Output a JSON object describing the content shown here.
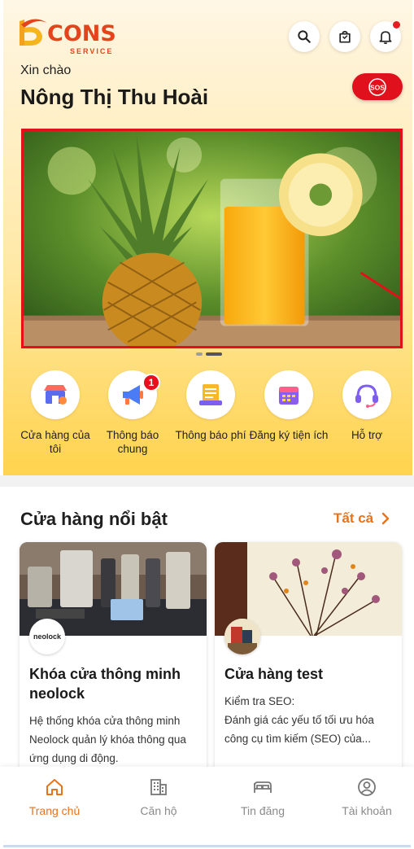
{
  "brand": {
    "name": "CONS",
    "sub": "SERVICE"
  },
  "header": {
    "greeting": "Xin chào",
    "user_name": "Nông Thị Thu Hoài",
    "sos_label": "SOS"
  },
  "colors": {
    "accent": "#e8731a",
    "sos": "#e0101c",
    "badge": "#e8101c",
    "gradient_bottom": "#ffd34d"
  },
  "banner": {
    "active_page": 2,
    "page_count": 2
  },
  "shortcuts": [
    {
      "label": "Cửa hàng của tôi",
      "icon": "store-icon"
    },
    {
      "label": "Thông báo chung",
      "icon": "megaphone-icon",
      "badge": "1"
    },
    {
      "label": "Thông báo phí",
      "icon": "fee-notice-icon"
    },
    {
      "label": "Đăng ký tiện ích",
      "icon": "calendar-icon"
    },
    {
      "label": "Hỗ trợ",
      "icon": "headset-icon"
    }
  ],
  "featured": {
    "title": "Cửa hàng nổi bật",
    "see_all": "Tất cả",
    "stores": [
      {
        "name": "Khóa cửa thông minh neolock",
        "avatar_text": "neolock",
        "description": "Hệ thống khóa cửa thông minh Neolock quản lý khóa thông qua ứng dụng di động."
      },
      {
        "name": "Cửa hàng test",
        "description_line1": "Kiểm tra SEO:",
        "description": "Đánh giá các yếu tố tối ưu hóa công cụ tìm kiếm (SEO) của..."
      }
    ]
  },
  "tabs": [
    {
      "label": "Trang chủ",
      "icon": "home-icon",
      "active": true
    },
    {
      "label": "Căn hộ",
      "icon": "building-icon"
    },
    {
      "label": "Tin đăng",
      "icon": "bed-icon"
    },
    {
      "label": "Tài khoản",
      "icon": "account-icon"
    }
  ]
}
